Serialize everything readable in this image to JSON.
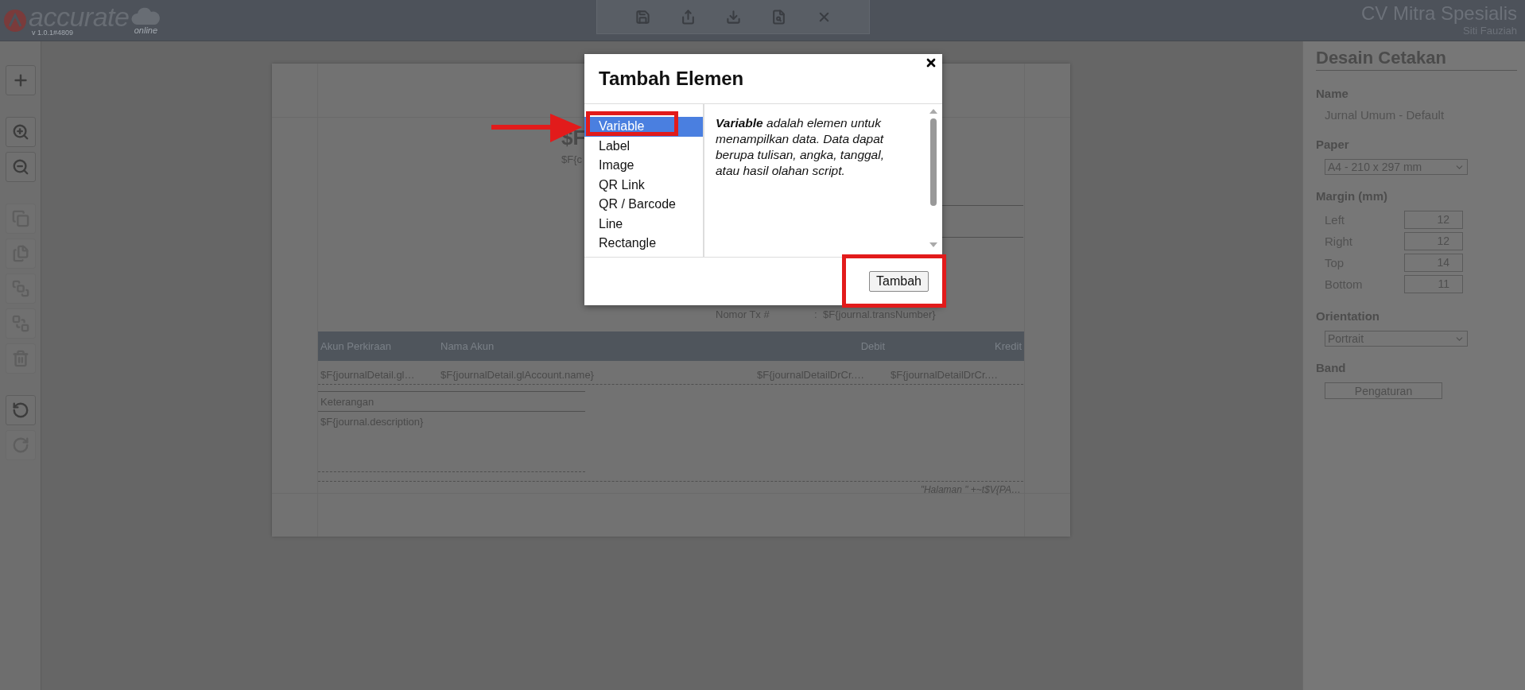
{
  "header": {
    "logo": {
      "wordmark": "accurate",
      "tagline": "online",
      "version": "v 1.0.1#4809"
    },
    "toolbar": [
      {
        "kind": "save"
      },
      {
        "kind": "export"
      },
      {
        "kind": "import"
      },
      {
        "kind": "preview"
      },
      {
        "kind": "close"
      }
    ],
    "company": "CV Mitra Spesialis",
    "user": "Siti Fauziah"
  },
  "side_tool_groups": [
    [
      {
        "kind": "add",
        "disabled": false
      }
    ],
    [
      {
        "kind": "zoom-in",
        "disabled": false
      },
      {
        "kind": "zoom-out",
        "disabled": false
      }
    ],
    [
      {
        "kind": "copy",
        "disabled": true
      },
      {
        "kind": "paste",
        "disabled": true
      },
      {
        "kind": "front",
        "disabled": true
      },
      {
        "kind": "back",
        "disabled": true
      },
      {
        "kind": "delete",
        "disabled": true
      }
    ],
    [
      {
        "kind": "undo",
        "disabled": false
      },
      {
        "kind": "redo",
        "disabled": true
      }
    ]
  ],
  "document": {
    "title": "$F",
    "subtitle": "$F{c",
    "tx_label": "Nomor Tx #",
    "tx_sep": ":",
    "tx_value": "$F{journal.transNumber}",
    "columns": [
      "Akun Perkiraan",
      "Nama Akun",
      "Debit",
      "Kredit"
    ],
    "row": [
      "$F{journalDetail.gl…",
      "$F{journalDetail.glAccount.name}",
      "$F{journalDetailDrCr.…",
      "$F{journalDetailDrCr.…"
    ],
    "note_label": "Keterangan",
    "note_value": "$F{journal.description}",
    "footer": "\"Halaman \" +~t$V{PA…"
  },
  "panel": {
    "title": "Desain Cetakan",
    "name_label": "Name",
    "name_value": "Jurnal Umum - Default",
    "paper_label": "Paper",
    "paper_value": "A4 - 210 x 297 mm",
    "margin_label": "Margin (mm)",
    "margins": [
      {
        "label": "Left",
        "value": "12"
      },
      {
        "label": "Right",
        "value": "12"
      },
      {
        "label": "Top",
        "value": "14"
      },
      {
        "label": "Bottom",
        "value": "11"
      }
    ],
    "orientation_label": "Orientation",
    "orientation_value": "Portrait",
    "band_label": "Band",
    "band_button": "Pengaturan"
  },
  "dialog": {
    "title": "Tambah Elemen",
    "items": [
      {
        "label": "Variable",
        "selected": true,
        "highlighted": true
      },
      {
        "label": "Label",
        "selected": false,
        "highlighted": false
      },
      {
        "label": "Image",
        "selected": false,
        "highlighted": false
      },
      {
        "label": "QR Link",
        "selected": false,
        "highlighted": false
      },
      {
        "label": "QR / Barcode",
        "selected": false,
        "highlighted": false
      },
      {
        "label": "Line",
        "selected": false,
        "highlighted": false
      },
      {
        "label": "Rectangle",
        "selected": false,
        "highlighted": false
      }
    ],
    "description": "**Variable** adalah elemen untuk menampilkan data. Data dapat berupa tulisan, angka, tanggal, atau hasil olahan script.",
    "button": {
      "label": "Tambah",
      "highlighted": true
    },
    "pointer_arrow": true
  }
}
